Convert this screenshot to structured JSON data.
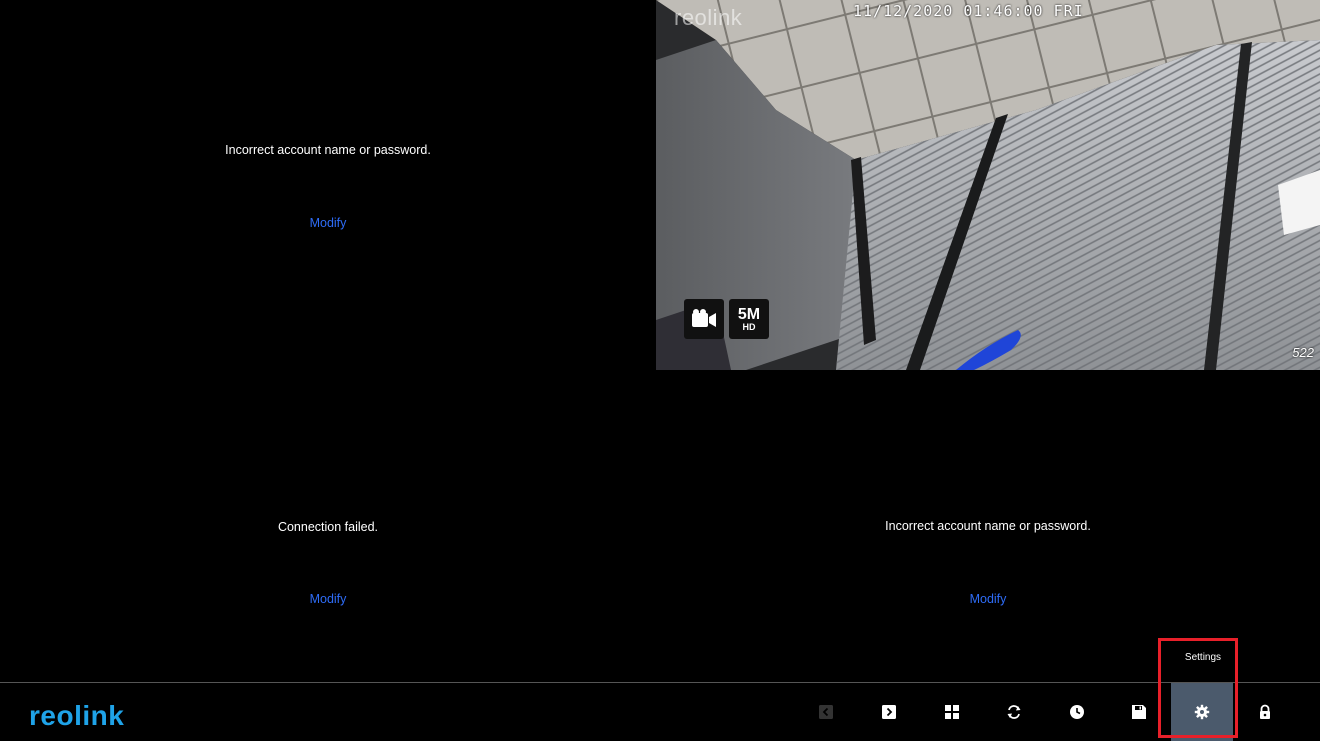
{
  "tiles": [
    {
      "message": "Incorrect account name or password.",
      "action": "Modify"
    },
    {
      "brand_watermark": "reolink",
      "timestamp": "11/12/2020 01:46:00 FRI",
      "corner_label": "522",
      "record_icon": "video-camera-icon",
      "resolution": "5M",
      "resolution_sub": "HD"
    },
    {
      "message": "Connection failed.",
      "action": "Modify"
    },
    {
      "message": "Incorrect account name or password.",
      "action": "Modify"
    }
  ],
  "bottom_bar": {
    "logo": "reolink",
    "logo_color": "#1fa3e8",
    "tools": [
      {
        "icon": "chevron-left-icon",
        "state": "disabled"
      },
      {
        "icon": "chevron-right-icon",
        "state": "normal"
      },
      {
        "icon": "grid-layout-icon",
        "state": "normal"
      },
      {
        "icon": "refresh-icon",
        "state": "normal"
      },
      {
        "icon": "clock-icon",
        "state": "normal"
      },
      {
        "icon": "save-icon",
        "state": "normal"
      },
      {
        "icon": "gear-icon",
        "state": "active"
      },
      {
        "icon": "lock-icon",
        "state": "normal"
      }
    ],
    "tooltip": "Settings"
  },
  "colors": {
    "link": "#2e6cf6",
    "active_tool_bg": "#4b5a6c",
    "highlight_border": "#e8202a"
  }
}
